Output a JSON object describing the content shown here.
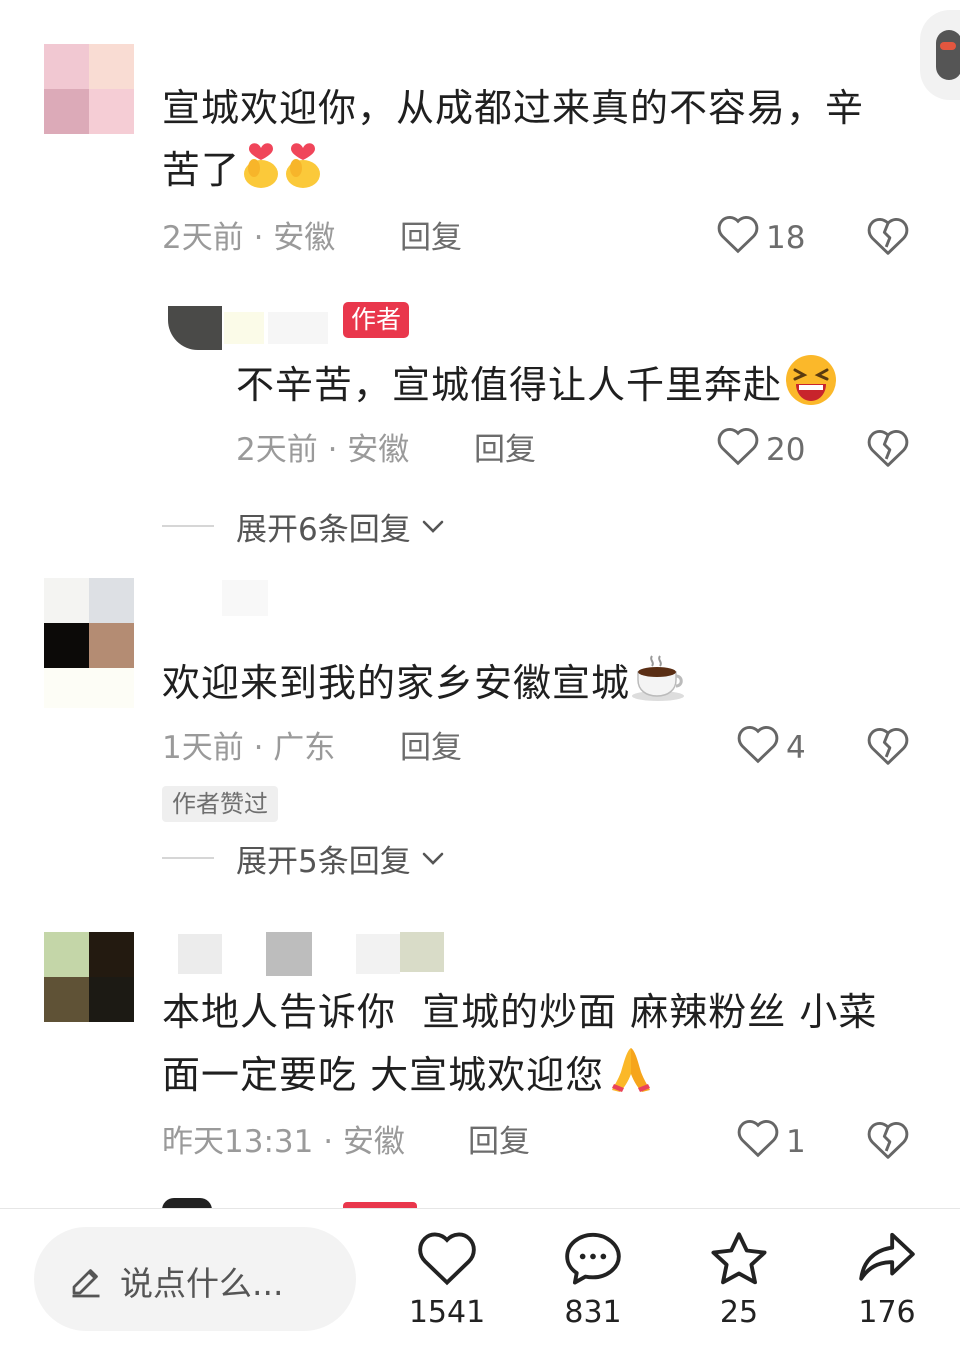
{
  "comments": [
    {
      "text": "宣城欢迎你，从成都过来真的不容易，辛苦了",
      "time": "2天前",
      "location": "安徽",
      "reply_label": "回复",
      "likes": "18",
      "emoji": [
        "finger-heart-emoji",
        "finger-heart-emoji"
      ],
      "author_reply": {
        "badge": "作者",
        "text": "不辛苦，宣城值得让人千里奔赴",
        "emoji": "laughing-face-emoji",
        "time": "2天前",
        "location": "安徽",
        "reply_label": "回复",
        "likes": "20"
      },
      "expand_label": "展开6条回复"
    },
    {
      "text": "欢迎来到我的家乡安徽宣城",
      "emoji": "coffee-cup-emoji",
      "time": "1天前",
      "location": "广东",
      "reply_label": "回复",
      "likes": "4",
      "author_liked_badge": "作者赞过",
      "expand_label": "展开5条回复"
    },
    {
      "text_line1": "本地人告诉你  宣城的炒面 麻辣粉丝 小菜",
      "text_line2": "面一定要吃 大宣城欢迎您",
      "emoji": "folded-hands-emoji",
      "time": "昨天13:31",
      "location": "安徽",
      "reply_label": "回复",
      "likes": "1"
    }
  ],
  "bottom_bar": {
    "input_placeholder": "说点什么...",
    "likes_count": "1541",
    "comments_count": "831",
    "favorites_count": "25",
    "shares_count": "176"
  },
  "colors": {
    "author_badge": "#e9374c",
    "meta_text": "#9a9a9a",
    "primary_text": "#1f1f1f"
  }
}
